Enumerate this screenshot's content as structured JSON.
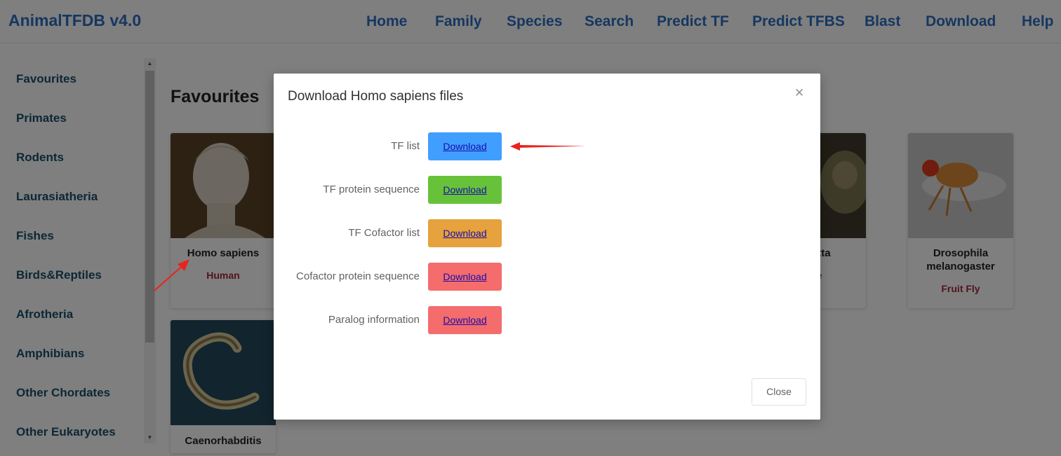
{
  "header": {
    "brand": "AnimalTFDB v4.0",
    "nav": [
      "Home",
      "Family",
      "Species",
      "Search",
      "Predict TF",
      "Predict TFBS",
      "Blast",
      "Download",
      "Help"
    ]
  },
  "sidebar": {
    "items": [
      "Favourites",
      "Primates",
      "Rodents",
      "Laurasiatheria",
      "Fishes",
      "Birds&Reptiles",
      "Afrotheria",
      "Amphibians",
      "Other Chordates",
      "Other Eukaryotes"
    ]
  },
  "main": {
    "title": "Favourites",
    "cards": [
      {
        "name": "Homo sapiens",
        "common": "Human"
      },
      {
        "name": "Caenorhabditis",
        "common": ""
      },
      {
        "name": "nulatta",
        "common": "que"
      },
      {
        "name": "Drosophila melanogaster",
        "common": "Fruit Fly"
      }
    ]
  },
  "modal": {
    "title": "Download Homo sapiens files",
    "rows": [
      {
        "label": "TF list",
        "button": "Download",
        "color": "#409eff"
      },
      {
        "label": "TF protein sequence",
        "button": "Download",
        "color": "#67c23a"
      },
      {
        "label": "TF Cofactor list",
        "button": "Download",
        "color": "#e6a23c"
      },
      {
        "label": "Cofactor protein sequence",
        "button": "Download",
        "color": "#f56c6c"
      },
      {
        "label": "Paralog information",
        "button": "Download",
        "color": "#f56c6c"
      }
    ],
    "close_label": "Close",
    "close_icon": "close-icon"
  },
  "colors": {
    "brand": "#2c6fc1",
    "sidebar_text": "#1b4f6a",
    "common_name": "#a3283c",
    "annotation_arrow": "#e8241c"
  }
}
